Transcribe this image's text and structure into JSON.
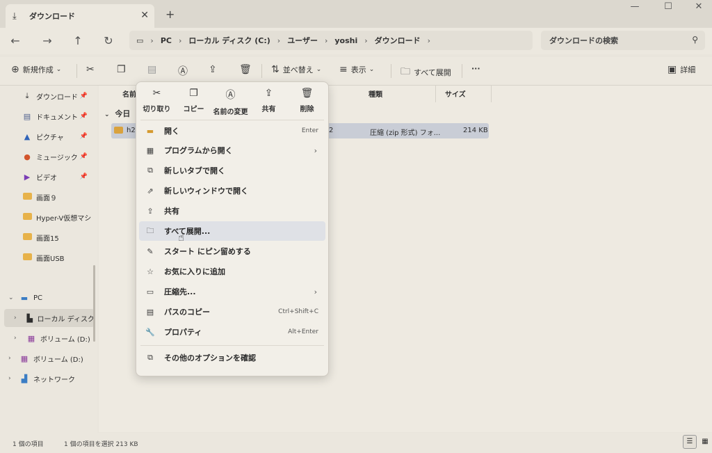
{
  "window": {
    "tab_title": "ダウンロード",
    "close_tab": "✕",
    "new_tab": "+",
    "minimize": "—",
    "maximize": "☐",
    "close": "✕"
  },
  "nav": {
    "breadcrumb": [
      "PC",
      "ローカル ディスク (C:)",
      "ユーザー",
      "yoshi",
      "ダウンロード"
    ],
    "search_placeholder": "ダウンロードの検索"
  },
  "toolbar": {
    "new_label": "新規作成",
    "sort_label": "並べ替え",
    "view_label": "表示",
    "extract_all_label": "すべて展開",
    "more_label": "···",
    "details_label": "詳細"
  },
  "sidebar": {
    "quick_access": [
      {
        "label": "ダウンロード",
        "icon": "download-icon"
      },
      {
        "label": "ドキュメント",
        "icon": "document-icon"
      },
      {
        "label": "ピクチャ",
        "icon": "picture-icon"
      },
      {
        "label": "ミュージック",
        "icon": "music-icon"
      },
      {
        "label": "ビデオ",
        "icon": "video-icon"
      }
    ],
    "folders": [
      "画面９",
      "Hyper-V仮想マシ",
      "画面15",
      "画面USB"
    ],
    "drives": [
      {
        "label": "PC"
      },
      {
        "label": "ローカル ディスク"
      },
      {
        "label": "ボリューム (D:)"
      },
      {
        "label": "ボリューム (D:)"
      },
      {
        "label": "ネットワーク"
      }
    ]
  },
  "columns": {
    "name": "名前",
    "type": "種類",
    "size": "サイズ"
  },
  "files": {
    "group_label": "今日",
    "rows": [
      {
        "name": "h2",
        "date_fragment": "2",
        "type": "圧縮 (zip 形式) フォ...",
        "size": "214 KB"
      }
    ]
  },
  "context_menu": {
    "quick_actions": [
      {
        "label": "切り取り",
        "icon": "cut-icon"
      },
      {
        "label": "コピー",
        "icon": "copy-icon"
      },
      {
        "label": "名前の変更",
        "icon": "rename-icon"
      },
      {
        "label": "共有",
        "icon": "share-icon"
      },
      {
        "label": "削除",
        "icon": "delete-icon"
      }
    ],
    "items": [
      {
        "label": "開く",
        "shortcut": "Enter"
      },
      {
        "label": "プログラムから開く",
        "submenu": "›"
      },
      {
        "label": "新しいタブで開く"
      },
      {
        "label": "新しいウィンドウで開く"
      },
      {
        "label": "共有"
      },
      {
        "label": "すべて展開..."
      },
      {
        "label": "スタート にピン留めする"
      },
      {
        "label": "お気に入りに追加"
      },
      {
        "label": "圧縮先...",
        "submenu": "›"
      },
      {
        "label": "パスのコピー",
        "shortcut": "Ctrl+Shift+C"
      },
      {
        "label": "プロパティ",
        "shortcut": "Alt+Enter"
      },
      {
        "label": "その他のオプションを確認"
      }
    ]
  },
  "status": {
    "item_count": "1 個の項目",
    "selection": "1 個の項目を選択 213 KB"
  }
}
